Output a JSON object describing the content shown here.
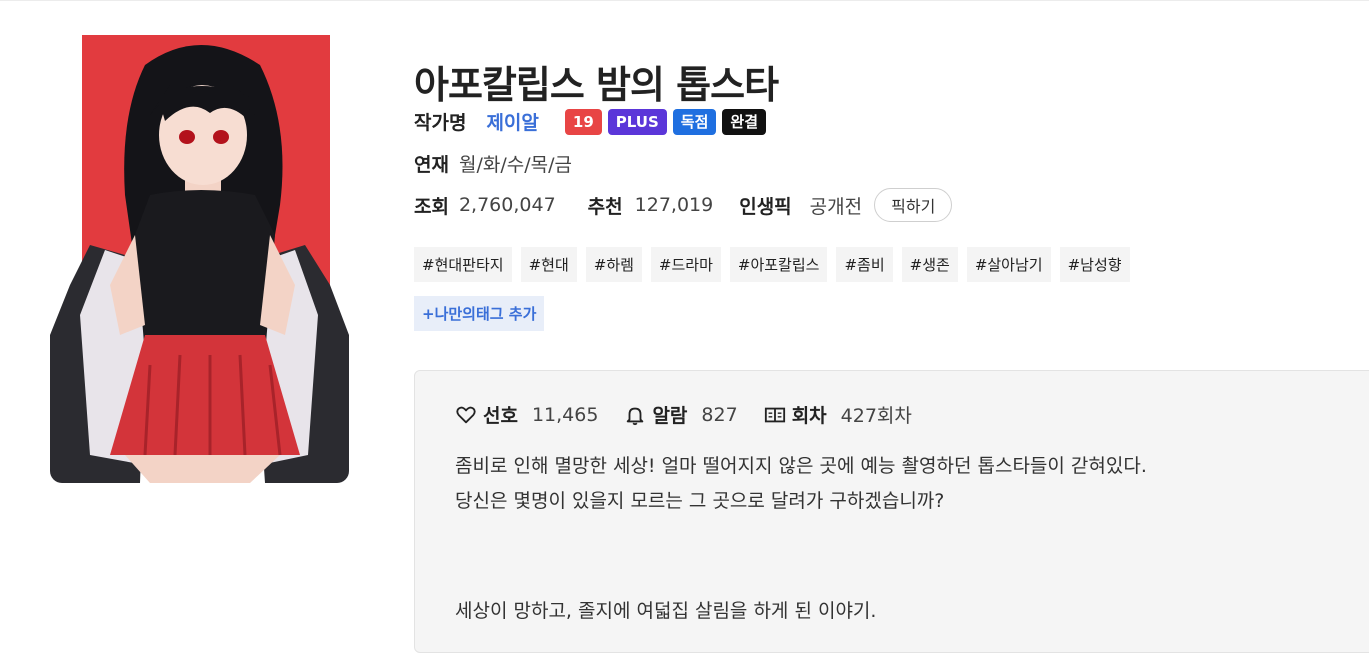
{
  "work": {
    "title": "아포칼립스 밤의 톱스타",
    "author_label": "작가명",
    "author": "제이알",
    "badges": [
      {
        "text": "19",
        "color": "#e84545"
      },
      {
        "text": "PLUS",
        "color": "#5b36d9"
      },
      {
        "text": "독점",
        "color": "#1f6fe0"
      },
      {
        "text": "완결",
        "color": "#111111"
      }
    ],
    "schedule_label": "연재",
    "schedule": "월/화/수/목/금",
    "views_label": "조회",
    "views": "2,760,047",
    "recommend_label": "추천",
    "recommend": "127,019",
    "pick_label": "인생픽",
    "pick_status": "공개전",
    "pick_button": "픽하기"
  },
  "tags": [
    "#현대판타지",
    "#현대",
    "#하렘",
    "#드라마",
    "#아포칼립스",
    "#좀비",
    "#생존",
    "#살아남기",
    "#남성향"
  ],
  "add_tag_label": "+나만의태그 추가",
  "stats": {
    "like_label": "선호",
    "like_value": "11,465",
    "alarm_label": "알람",
    "alarm_value": "827",
    "episode_label": "회차",
    "episode_value": "427회차"
  },
  "description": {
    "line1": "좀비로 인해 멸망한 세상! 얼마 떨어지지 않은 곳에 예능 촬영하던 톱스타들이 갇혀있다.",
    "line2": "당신은 몇명이 있을지 모르는 그 곳으로 달려가 구하겠습니까?",
    "line3": "세상이 망하고, 졸지에 여덟집 살림을 하게 된 이야기."
  },
  "colors": {
    "accent_blue": "#3a6fd8",
    "cover_red": "#e23b3f"
  }
}
